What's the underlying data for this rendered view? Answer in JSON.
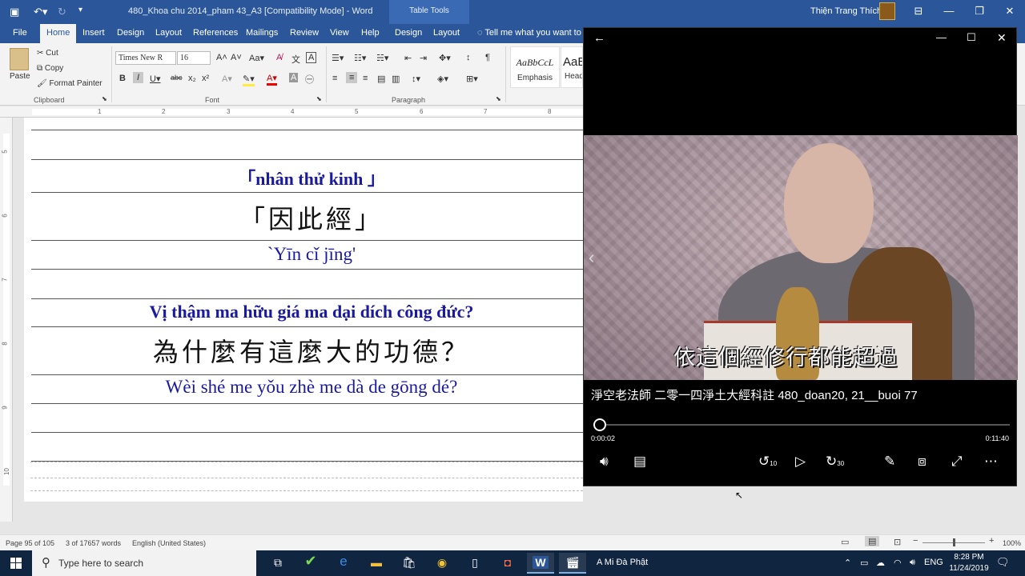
{
  "titlebar": {
    "doc_title": "480_Khoa chu 2014_pham 43_A3 [Compatibility Mode]  -  Word",
    "table_tools": "Table Tools",
    "user_name": "Thiện Trang Thích"
  },
  "ribbon_tabs": [
    "File",
    "Home",
    "Insert",
    "Design",
    "Layout",
    "References",
    "Mailings",
    "Review",
    "View",
    "Help",
    "Design",
    "Layout"
  ],
  "tell_me": "Tell me what you want to",
  "clipboard": {
    "paste": "Paste",
    "cut": "Cut",
    "copy": "Copy",
    "format_painter": "Format Painter",
    "group": "Clipboard"
  },
  "font": {
    "name": "Times New R",
    "size": "16",
    "group": "Font"
  },
  "paragraph": {
    "group": "Paragraph"
  },
  "styles": [
    {
      "preview": "AaBbCcL",
      "name": "Emphasis"
    },
    {
      "preview": "AaB",
      "name": "Head"
    }
  ],
  "document": {
    "rows": [
      {
        "kind": "empty",
        "text": ""
      },
      {
        "kind": "viet",
        "text": "「nhân thử kinh 」"
      },
      {
        "kind": "han",
        "text": "「因此經」"
      },
      {
        "kind": "pinyin",
        "text": "`Yīn cǐ jīng'"
      },
      {
        "kind": "empty",
        "text": ""
      },
      {
        "kind": "viet",
        "text": "Vị thậm ma hữu giá ma dại dích công đức?"
      },
      {
        "kind": "han",
        "text": "為什麼有這麼大的功德？"
      },
      {
        "kind": "pinyin",
        "text": "Wèi shé me yǒu zhè me dà de gōng dé?"
      },
      {
        "kind": "empty",
        "text": ""
      },
      {
        "kind": "empty",
        "text": ""
      }
    ]
  },
  "statusbar": {
    "page": "Page 95 of 105",
    "words": "3 of 17657 words",
    "language": "English (United States)",
    "zoom": "100%",
    "zoom_level": 0.5
  },
  "player": {
    "subtitle": "依這個經修行都能超過",
    "title": "淨空老法師 二零一四淨土大經科註 480_doan20, 21__buoi 77",
    "current_time": "0:00:02",
    "total_time": "0:11:40",
    "progress": 0.003,
    "skip_back": "10",
    "skip_forward": "30"
  },
  "taskbar": {
    "search_placeholder": "Type here to search",
    "active_task": "A Mi Đà Phật",
    "language": "ENG",
    "time": "8:28 PM",
    "date": "11/24/2019"
  }
}
